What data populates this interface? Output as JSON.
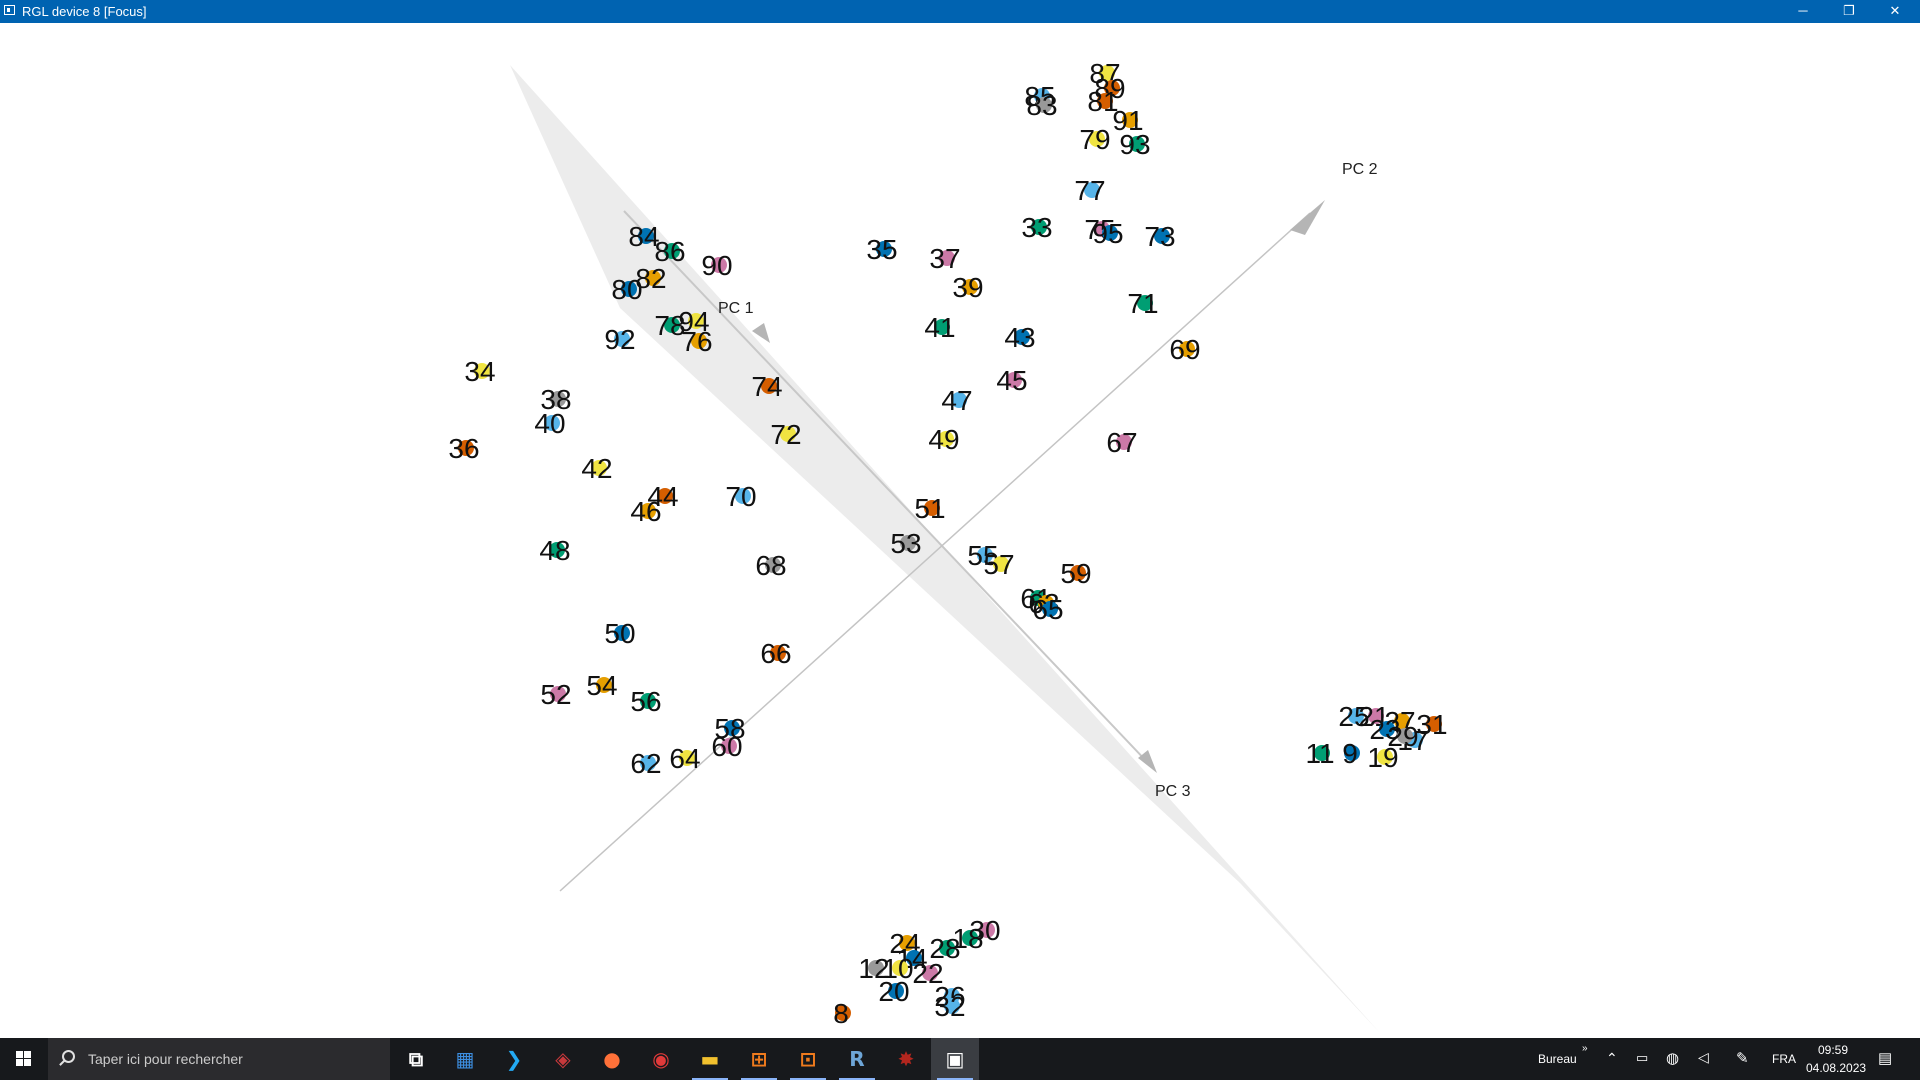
{
  "window": {
    "title": "RGL device 8 [Focus]",
    "controls": {
      "minimize": "─",
      "restore": "❐",
      "close": "✕"
    }
  },
  "plot": {
    "axis_labels": {
      "pc1": "PC 1",
      "pc2": "PC 2",
      "pc3": "PC 3"
    },
    "points": [
      {
        "label": "87",
        "color": "#f0e442"
      },
      {
        "label": "89",
        "color": "#d55e00"
      },
      {
        "label": "85",
        "color": "#56b4e9"
      },
      {
        "label": "83",
        "color": "#999999"
      },
      {
        "label": "81",
        "color": "#d55e00"
      },
      {
        "label": "91",
        "color": "#e69f00"
      },
      {
        "label": "79",
        "color": "#f0e442"
      },
      {
        "label": "93",
        "color": "#009e73"
      },
      {
        "label": "77",
        "color": "#56b4e9"
      },
      {
        "label": "33",
        "color": "#009e73"
      },
      {
        "label": "75",
        "color": "#cc79a7"
      },
      {
        "label": "95",
        "color": "#0072b2"
      },
      {
        "label": "73",
        "color": "#0072b2"
      },
      {
        "label": "35",
        "color": "#0072b2"
      },
      {
        "label": "37",
        "color": "#cc79a7"
      },
      {
        "label": "39",
        "color": "#e69f00"
      },
      {
        "label": "71",
        "color": "#009e73"
      },
      {
        "label": "41",
        "color": "#009e73"
      },
      {
        "label": "43",
        "color": "#0072b2"
      },
      {
        "label": "69",
        "color": "#e69f00"
      },
      {
        "label": "45",
        "color": "#cc79a7"
      },
      {
        "label": "47",
        "color": "#56b4e9"
      },
      {
        "label": "49",
        "color": "#f0e442"
      },
      {
        "label": "67",
        "color": "#cc79a7"
      },
      {
        "label": "51",
        "color": "#d55e00"
      },
      {
        "label": "53",
        "color": "#999999"
      },
      {
        "label": "55",
        "color": "#56b4e9"
      },
      {
        "label": "57",
        "color": "#f0e442"
      },
      {
        "label": "59",
        "color": "#d55e00"
      },
      {
        "label": "61",
        "color": "#009e73"
      },
      {
        "label": "63",
        "color": "#e69f00"
      },
      {
        "label": "65",
        "color": "#0072b2"
      },
      {
        "label": "84",
        "color": "#0072b2"
      },
      {
        "label": "86",
        "color": "#009e73"
      },
      {
        "label": "90",
        "color": "#cc79a7"
      },
      {
        "label": "82",
        "color": "#e69f00"
      },
      {
        "label": "80",
        "color": "#0072b2"
      },
      {
        "label": "78",
        "color": "#009e73"
      },
      {
        "label": "94",
        "color": "#f0e442"
      },
      {
        "label": "76",
        "color": "#e69f00"
      },
      {
        "label": "92",
        "color": "#56b4e9"
      },
      {
        "label": "34",
        "color": "#f0e442"
      },
      {
        "label": "38",
        "color": "#999999"
      },
      {
        "label": "40",
        "color": "#56b4e9"
      },
      {
        "label": "74",
        "color": "#d55e00"
      },
      {
        "label": "72",
        "color": "#f0e442"
      },
      {
        "label": "36",
        "color": "#d55e00"
      },
      {
        "label": "42",
        "color": "#f0e442"
      },
      {
        "label": "44",
        "color": "#d55e00"
      },
      {
        "label": "46",
        "color": "#e69f00"
      },
      {
        "label": "70",
        "color": "#56b4e9"
      },
      {
        "label": "48",
        "color": "#009e73"
      },
      {
        "label": "68",
        "color": "#999999"
      },
      {
        "label": "50",
        "color": "#0072b2"
      },
      {
        "label": "66",
        "color": "#d55e00"
      },
      {
        "label": "52",
        "color": "#cc79a7"
      },
      {
        "label": "54",
        "color": "#e69f00"
      },
      {
        "label": "56",
        "color": "#009e73"
      },
      {
        "label": "58",
        "color": "#0072b2"
      },
      {
        "label": "60",
        "color": "#cc79a7"
      },
      {
        "label": "62",
        "color": "#56b4e9"
      },
      {
        "label": "64",
        "color": "#f0e442"
      },
      {
        "label": "25",
        "color": "#56b4e9"
      },
      {
        "label": "21",
        "color": "#cc79a7"
      },
      {
        "label": "27",
        "color": "#e69f00"
      },
      {
        "label": "23",
        "color": "#0072b2"
      },
      {
        "label": "11",
        "color": "#009e73"
      },
      {
        "label": "9",
        "color": "#0072b2"
      },
      {
        "label": "19",
        "color": "#f0e442"
      },
      {
        "label": "17",
        "color": "#56b4e9"
      },
      {
        "label": "31",
        "color": "#d55e00"
      },
      {
        "label": "29",
        "color": "#999999"
      },
      {
        "label": "30",
        "color": "#cc79a7"
      },
      {
        "label": "18",
        "color": "#009e73"
      },
      {
        "label": "28",
        "color": "#009e73"
      },
      {
        "label": "24",
        "color": "#e69f00"
      },
      {
        "label": "14",
        "color": "#0072b2"
      },
      {
        "label": "12",
        "color": "#999999"
      },
      {
        "label": "10",
        "color": "#f0e442"
      },
      {
        "label": "22",
        "color": "#cc79a7"
      },
      {
        "label": "20",
        "color": "#0072b2"
      },
      {
        "label": "26",
        "color": "#56b4e9"
      },
      {
        "label": "32",
        "color": "#56b4e9"
      },
      {
        "label": "8",
        "color": "#d55e00"
      }
    ]
  },
  "taskbar": {
    "search_placeholder": "Taper ici pour rechercher",
    "apps": [
      {
        "name": "task-view-icon",
        "glyph": "⧉",
        "color": "#ffffff"
      },
      {
        "name": "store-icon",
        "glyph": "▦",
        "color": "#3d8ee0"
      },
      {
        "name": "visual-studio-code-icon",
        "glyph": "❯",
        "color": "#23a9f2"
      },
      {
        "name": "rstudio-icon",
        "glyph": "◈",
        "color": "#c8393c"
      },
      {
        "name": "firefox-icon",
        "glyph": "●",
        "color": "#ff7139"
      },
      {
        "name": "camera-icon",
        "glyph": "◉",
        "color": "#e03a3a"
      },
      {
        "name": "file-explorer-icon",
        "glyph": "▬",
        "color": "#f2c12e"
      },
      {
        "name": "orange-app-icon",
        "glyph": "⊞",
        "color": "#f07b1d"
      },
      {
        "name": "orange-app-2-icon",
        "glyph": "⊡",
        "color": "#f07b1d"
      },
      {
        "name": "r-icon",
        "glyph": "R",
        "color": "#6ea6d8"
      },
      {
        "name": "red-app-icon",
        "glyph": "✸",
        "color": "#b3261e"
      },
      {
        "name": "rgl-window-icon",
        "glyph": "▣",
        "color": "#ffffff"
      }
    ],
    "tray": {
      "bureau": "Bureau",
      "chevron": "»",
      "language": "FRA",
      "time": "09:59",
      "date": "04.08.2023"
    }
  }
}
